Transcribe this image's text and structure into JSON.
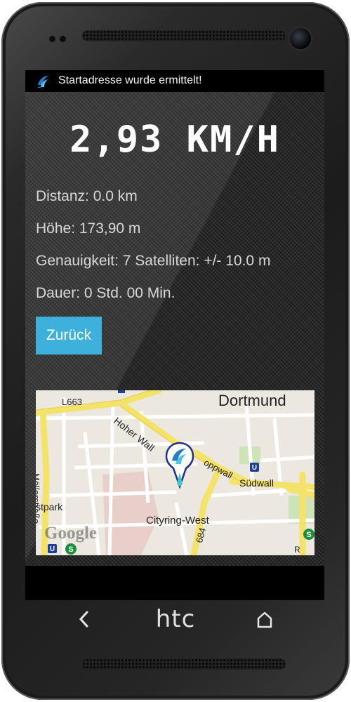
{
  "device": {
    "brand": "htc"
  },
  "statusbar": {
    "notification": "Startadresse wurde ermittelt!",
    "icon": "app-logo-icon"
  },
  "speed": "2,93 KM/H",
  "info": {
    "distance": "Distanz: 0.0 km",
    "altitude": "Höhe: 173,90 m",
    "accuracy": "Genauigkeit: 7 Satelliten: +/- 10.0 m",
    "duration": "Dauer: 0 Std. 00 Min."
  },
  "back_button": "Zurück",
  "map": {
    "city": "Dortmund",
    "streets": [
      "L663",
      "Hoher Wall",
      "Möllerstraße",
      "Südwall",
      "Cityring-West",
      "stpark",
      "684",
      "R",
      "oppwall"
    ],
    "attribution": "Google",
    "marker": "location-pin-icon"
  },
  "navbar": {
    "back": "‹",
    "home": "⌂"
  },
  "colors": {
    "accent": "#3db1dc",
    "screen_bg": "#2b2b2b",
    "text": "#d8d8d8"
  }
}
